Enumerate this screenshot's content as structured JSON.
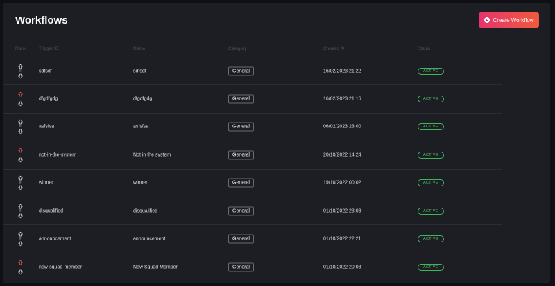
{
  "header": {
    "title": "Workflows",
    "create_label": "Create Workflow"
  },
  "columns": [
    "Rank",
    "Trigger ID",
    "Name",
    "Category",
    "Created At",
    "Status"
  ],
  "colors": {
    "accent_start": "#e8336f",
    "accent_end": "#f05a3c",
    "status_green": "#54c86c",
    "arrow_up_highlight": "#e05a5a"
  },
  "rows": [
    {
      "rank": "0",
      "up_highlight": false,
      "trigger_id": "sdfsdf",
      "name": "sdfsdf",
      "category": "General",
      "created_at": "16/02/2023 21:22",
      "status": "ACTIVE"
    },
    {
      "rank": "",
      "up_highlight": true,
      "trigger_id": "dfgdfgdg",
      "name": "dfgdfgdg",
      "category": "General",
      "created_at": "16/02/2023 21:16",
      "status": "ACTIVE"
    },
    {
      "rank": "0",
      "up_highlight": false,
      "trigger_id": "asfsfsa",
      "name": "asfsfsa",
      "category": "General",
      "created_at": "06/02/2023 23:00",
      "status": "ACTIVE"
    },
    {
      "rank": "",
      "up_highlight": true,
      "trigger_id": "not-in-the-system",
      "name": "Not in the system",
      "category": "General",
      "created_at": "20/10/2022 14:24",
      "status": "ACTIVE"
    },
    {
      "rank": "0",
      "up_highlight": false,
      "trigger_id": "winner",
      "name": "winner",
      "category": "General",
      "created_at": "19/10/2022 00:02",
      "status": "ACTIVE"
    },
    {
      "rank": "0",
      "up_highlight": false,
      "trigger_id": "disqualified",
      "name": "disqualified",
      "category": "General",
      "created_at": "01/10/2022 23:03",
      "status": "ACTIVE"
    },
    {
      "rank": "0",
      "up_highlight": false,
      "trigger_id": "announcement",
      "name": "announcement",
      "category": "General",
      "created_at": "01/10/2022 22:21",
      "status": "ACTIVE"
    },
    {
      "rank": "",
      "up_highlight": true,
      "trigger_id": "new-squad-member",
      "name": "New Squad Member",
      "category": "General",
      "created_at": "01/10/2022 20:03",
      "status": "ACTIVE"
    }
  ]
}
